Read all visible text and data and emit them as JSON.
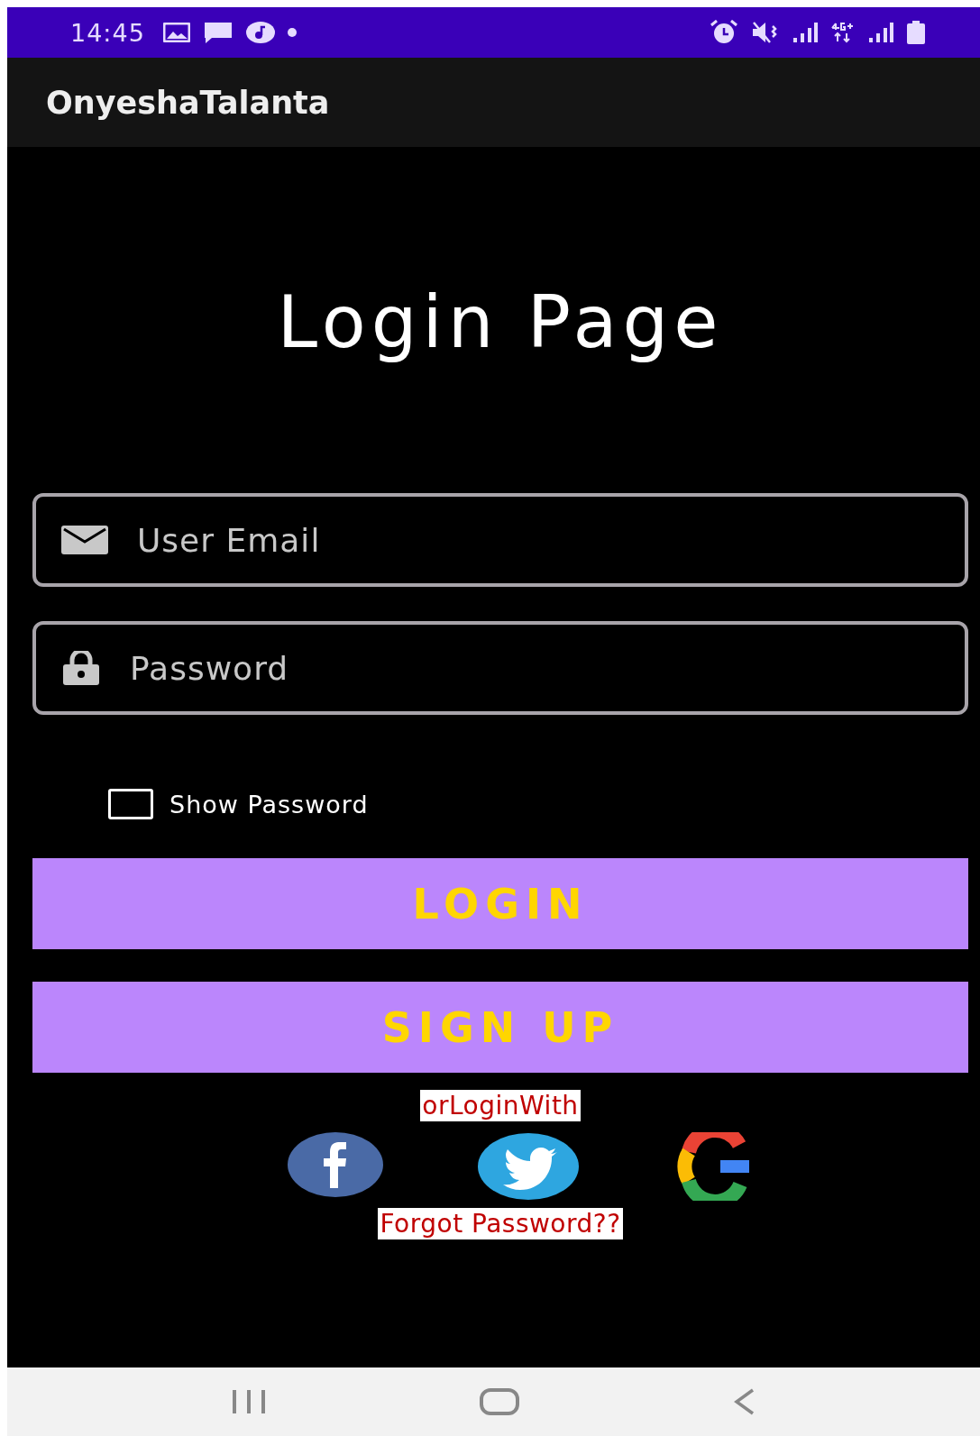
{
  "status_bar": {
    "time": "14:45"
  },
  "app_bar": {
    "title": "OnyeshaTalanta"
  },
  "heading": "Login Page",
  "fields": [
    {
      "kind": "email",
      "placeholder": "User Email"
    },
    {
      "kind": "password",
      "placeholder": "Password"
    }
  ],
  "show_password": {
    "label": "Show Password",
    "checked": false
  },
  "buttons": [
    "LOGIN",
    "SIGN UP"
  ],
  "or_login_with": "orLoginWith",
  "social": [
    {
      "kind": "facebook"
    },
    {
      "kind": "twitter"
    },
    {
      "kind": "google"
    }
  ],
  "forgot_password": "Forgot Password??"
}
